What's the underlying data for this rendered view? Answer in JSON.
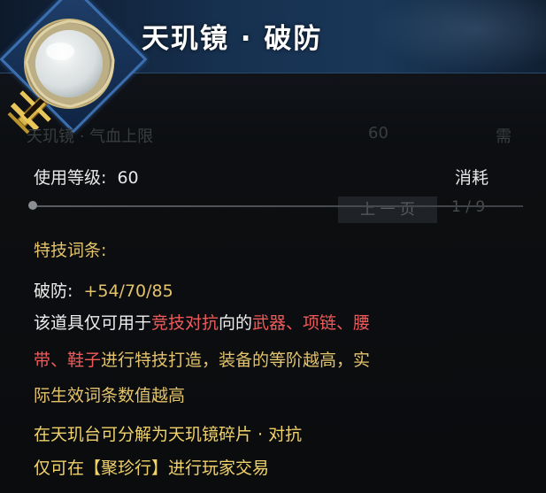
{
  "tooltip": {
    "title": "天玑镜 · 破防",
    "ghost_row": {
      "name": "天玑镜 · 气血上限",
      "value": "60",
      "right": "需"
    },
    "use_level_label": "使用等级:",
    "use_level_value": "60",
    "consume_label": "消耗",
    "ghost_page_button": "上 一 页",
    "ghost_page_num": "1 / 9",
    "section_label": "特技词条:",
    "stat_label": "破防:",
    "stat_value": "+54/70/85",
    "desc": {
      "l1_a": "该道具仅可用于",
      "l1_b": "竞技对抗",
      "l1_c": "向的",
      "l1_d": "武器、项链、腰",
      "l2_a": "带、鞋子",
      "l2_b": "进行特技打造，装备的等阶越高，实",
      "l3": "际生效词条数值越高",
      "l4": "在天玑台可分解为天玑镜碎片 · 对抗",
      "l5": "仅可在【聚珍行】进行玩家交易"
    }
  },
  "colors": {
    "header_accent": "#3b6fb0",
    "label_gold": "#e3c36b",
    "highlight_red": "#ef5b5b",
    "text_white": "#eeeeee"
  }
}
